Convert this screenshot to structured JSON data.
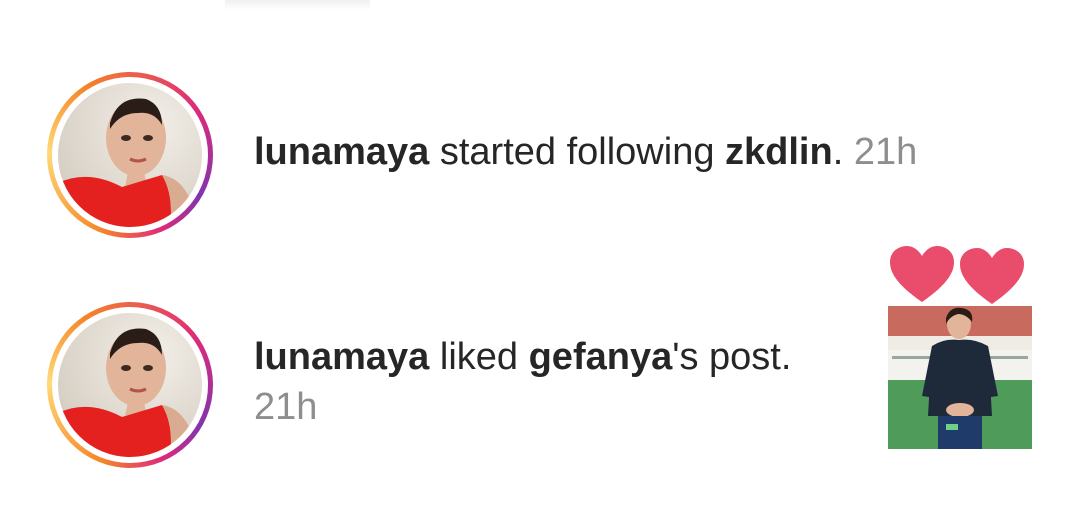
{
  "notifications": [
    {
      "user": "lunamaya",
      "action": " started following ",
      "target": "zkdlin",
      "suffix": ". ",
      "time": "21h"
    },
    {
      "user": "lunamaya",
      "action": " liked ",
      "target": "gefanya",
      "suffix": "'s post.",
      "time": "21h"
    }
  ],
  "icons": {
    "avatar": "profile-photo",
    "hearts": "heart-icon",
    "thumbnail": "post-thumbnail"
  },
  "colors": {
    "story_ring_start": "#f58529",
    "story_ring_mid": "#dd2a7b",
    "story_ring_end": "#8134af",
    "timestamp": "#8e8e8e",
    "heart": "#ea4c6c"
  }
}
